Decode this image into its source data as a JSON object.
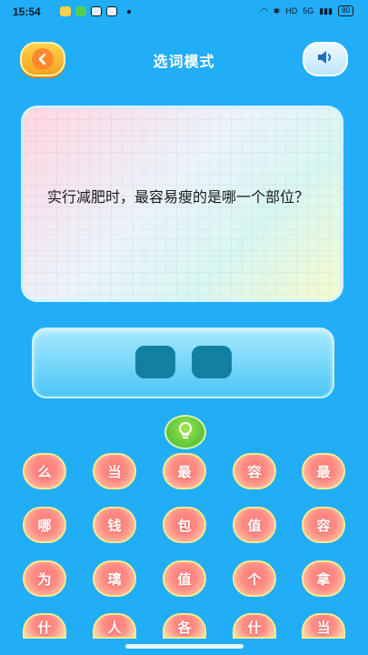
{
  "status_bar": {
    "time": "15:54",
    "app_icon_colors": [
      "#ffd045",
      "#4ecf5a",
      "#e8f2ff",
      "#e8f2ff"
    ],
    "network": "HD",
    "signal": "5G",
    "battery": "80"
  },
  "header": {
    "title": "选词模式",
    "back_icon": "back-arrow-icon",
    "sound_icon": "speaker-icon"
  },
  "question": {
    "text": "实行减肥时，最容易瘦的是哪一个部位？"
  },
  "answer": {
    "slots": [
      "",
      ""
    ]
  },
  "hint": {
    "icon": "lightbulb-icon"
  },
  "choices": {
    "rows": [
      [
        "么",
        "当",
        "最",
        "容",
        "最"
      ],
      [
        "哪",
        "钱",
        "包",
        "值",
        "容"
      ],
      [
        "为",
        "璃",
        "值",
        "个",
        "拿"
      ],
      [
        "什",
        "人",
        "各",
        "什",
        "当"
      ]
    ]
  },
  "colors": {
    "background": "#21aef6",
    "tile": "#ff8c84",
    "slot": "#137fa3",
    "accent": "#ffd34a"
  }
}
